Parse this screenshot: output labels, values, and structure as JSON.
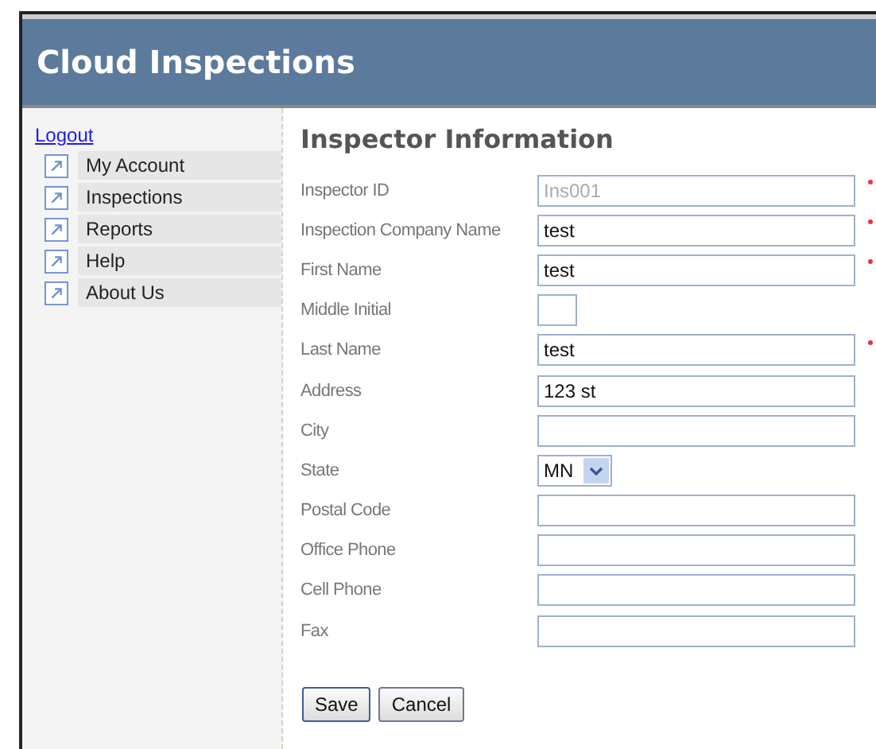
{
  "header": {
    "title": "Cloud Inspections"
  },
  "sidebar": {
    "logout": "Logout",
    "items": [
      {
        "label": "My Account"
      },
      {
        "label": "Inspections"
      },
      {
        "label": "Reports"
      },
      {
        "label": "Help"
      },
      {
        "label": "About Us"
      }
    ]
  },
  "form": {
    "title": "Inspector Information",
    "fields": [
      {
        "label": "Inspector ID",
        "kind": "readonly",
        "value": "Ins001",
        "required": true
      },
      {
        "label": "Inspection Company Name",
        "kind": "text",
        "value": "test",
        "required": true
      },
      {
        "label": "First Name",
        "kind": "text",
        "value": "test",
        "required": true
      },
      {
        "label": "Middle Initial",
        "kind": "short",
        "required": false
      },
      {
        "label": "Last Name",
        "kind": "text",
        "value": "test",
        "required": true
      },
      {
        "label": "Address",
        "kind": "text",
        "value": "123 st",
        "required": false
      },
      {
        "label": "City",
        "kind": "text",
        "required": false
      },
      {
        "label": "State",
        "kind": "select",
        "value": "MN",
        "required": false
      },
      {
        "label": "Postal Code",
        "kind": "text",
        "required": false
      },
      {
        "label": "Office Phone",
        "kind": "text",
        "required": false
      },
      {
        "label": "Cell Phone",
        "kind": "text",
        "required": false
      },
      {
        "label": "Fax",
        "kind": "text",
        "required": false
      }
    ],
    "buttons": [
      "Save",
      "Cancel"
    ]
  }
}
